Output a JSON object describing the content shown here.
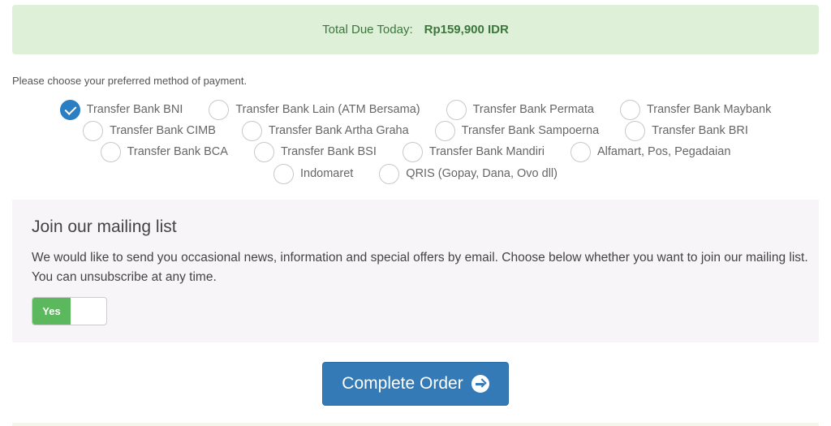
{
  "total": {
    "label": "Total Due Today:",
    "amount": "Rp159,900 IDR"
  },
  "payment": {
    "prompt": "Please choose your preferred method of payment.",
    "rows": [
      [
        {
          "label": "Transfer Bank BNI",
          "checked": true
        },
        {
          "label": "Transfer Bank Lain (ATM Bersama)",
          "checked": false
        },
        {
          "label": "Transfer Bank Permata",
          "checked": false
        },
        {
          "label": "Transfer Bank Maybank",
          "checked": false
        }
      ],
      [
        {
          "label": "Transfer Bank CIMB",
          "checked": false
        },
        {
          "label": "Transfer Bank Artha Graha",
          "checked": false
        },
        {
          "label": "Transfer Bank Sampoerna",
          "checked": false
        },
        {
          "label": "Transfer Bank BRI",
          "checked": false
        }
      ],
      [
        {
          "label": "Transfer Bank BCA",
          "checked": false
        },
        {
          "label": "Transfer Bank BSI",
          "checked": false
        },
        {
          "label": "Transfer Bank Mandiri",
          "checked": false
        },
        {
          "label": "Alfamart, Pos, Pegadaian",
          "checked": false
        }
      ],
      [
        {
          "label": "Indomaret",
          "checked": false
        },
        {
          "label": "QRIS (Gopay, Dana, Ovo dll)",
          "checked": false
        }
      ]
    ]
  },
  "mailing": {
    "title": "Join our mailing list",
    "description": "We would like to send you occasional news, information and special offers by email. Choose below whether you want to join our mailing list. You can unsubscribe at any time.",
    "toggle_label": "Yes"
  },
  "complete_order": {
    "label": "Complete Order",
    "icon": "arrow-circle-right-icon"
  },
  "colors": {
    "accent": "#337ab7",
    "success_bg": "#dff0d8",
    "toggle_on": "#5cb85c"
  }
}
